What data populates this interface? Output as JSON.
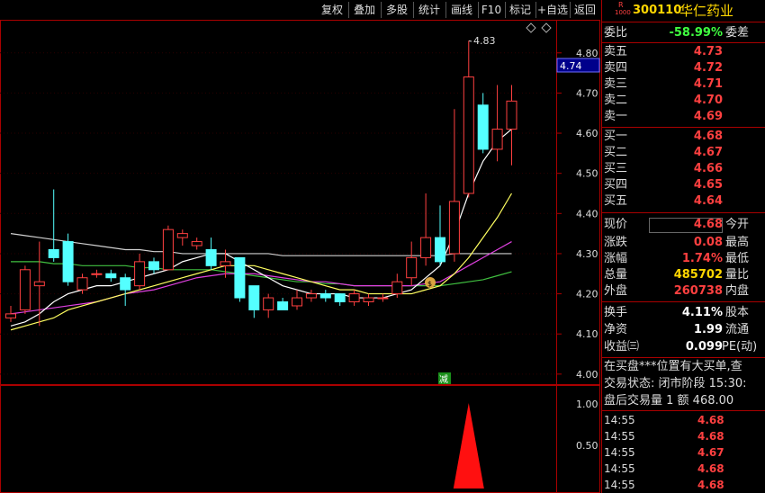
{
  "toolbar": {
    "buttons": [
      "复权",
      "叠加",
      "多股",
      "统计",
      "画线",
      "F10",
      "标记",
      "+自选",
      "返回"
    ]
  },
  "chart": {
    "price_axis_labels": [
      "4.80",
      "4.70",
      "4.60",
      "4.50",
      "4.40",
      "4.30",
      "4.20",
      "4.10",
      "4.00"
    ],
    "current_price_tag": "4.74",
    "high_marker": "4.83",
    "jian_label": "减",
    "indicator_axis_labels": [
      "1.00",
      "0.50"
    ]
  },
  "chart_data": {
    "type": "candlestick",
    "ylim": [
      3.975,
      4.86
    ],
    "candles": [
      {
        "o": 4.14,
        "c": 4.15,
        "h": 4.17,
        "l": 4.13
      },
      {
        "o": 4.16,
        "c": 4.26,
        "h": 4.27,
        "l": 4.15
      },
      {
        "o": 4.22,
        "c": 4.23,
        "h": 4.33,
        "l": 4.12
      },
      {
        "o": 4.31,
        "c": 4.29,
        "h": 4.46,
        "l": 4.28
      },
      {
        "o": 4.33,
        "c": 4.23,
        "h": 4.35,
        "l": 4.22
      },
      {
        "o": 4.21,
        "c": 4.24,
        "h": 4.25,
        "l": 4.2
      },
      {
        "o": 4.25,
        "c": 4.25,
        "h": 4.26,
        "l": 4.24
      },
      {
        "o": 4.25,
        "c": 4.24,
        "h": 4.26,
        "l": 4.23
      },
      {
        "o": 4.24,
        "c": 4.21,
        "h": 4.25,
        "l": 4.17
      },
      {
        "o": 4.22,
        "c": 4.28,
        "h": 4.3,
        "l": 4.21
      },
      {
        "o": 4.28,
        "c": 4.26,
        "h": 4.29,
        "l": 4.25
      },
      {
        "o": 4.26,
        "c": 4.36,
        "h": 4.37,
        "l": 4.26
      },
      {
        "o": 4.34,
        "c": 4.35,
        "h": 4.36,
        "l": 4.32
      },
      {
        "o": 4.32,
        "c": 4.33,
        "h": 4.34,
        "l": 4.31
      },
      {
        "o": 4.31,
        "c": 4.27,
        "h": 4.34,
        "l": 4.26
      },
      {
        "o": 4.27,
        "c": 4.28,
        "h": 4.31,
        "l": 4.24
      },
      {
        "o": 4.29,
        "c": 4.19,
        "h": 4.29,
        "l": 4.18
      },
      {
        "o": 4.22,
        "c": 4.16,
        "h": 4.22,
        "l": 4.14
      },
      {
        "o": 4.16,
        "c": 4.19,
        "h": 4.2,
        "l": 4.14
      },
      {
        "o": 4.18,
        "c": 4.16,
        "h": 4.19,
        "l": 4.16
      },
      {
        "o": 4.17,
        "c": 4.19,
        "h": 4.21,
        "l": 4.16
      },
      {
        "o": 4.19,
        "c": 4.2,
        "h": 4.21,
        "l": 4.18
      },
      {
        "o": 4.2,
        "c": 4.19,
        "h": 4.21,
        "l": 4.18
      },
      {
        "o": 4.2,
        "c": 4.18,
        "h": 4.2,
        "l": 4.17
      },
      {
        "o": 4.18,
        "c": 4.2,
        "h": 4.21,
        "l": 4.17
      },
      {
        "o": 4.18,
        "c": 4.19,
        "h": 4.2,
        "l": 4.17
      },
      {
        "o": 4.19,
        "c": 4.19,
        "h": 4.2,
        "l": 4.18
      },
      {
        "o": 4.2,
        "c": 4.23,
        "h": 4.25,
        "l": 4.19
      },
      {
        "o": 4.24,
        "c": 4.29,
        "h": 4.33,
        "l": 4.22
      },
      {
        "o": 4.29,
        "c": 4.34,
        "h": 4.45,
        "l": 4.27
      },
      {
        "o": 4.34,
        "c": 4.28,
        "h": 4.42,
        "l": 4.27
      },
      {
        "o": 4.3,
        "c": 4.43,
        "h": 4.66,
        "l": 4.28
      },
      {
        "o": 4.45,
        "c": 4.74,
        "h": 4.83,
        "l": 4.44
      },
      {
        "o": 4.67,
        "c": 4.56,
        "h": 4.7,
        "l": 4.55
      },
      {
        "o": 4.56,
        "c": 4.61,
        "h": 4.72,
        "l": 4.53
      },
      {
        "o": 4.61,
        "c": 4.68,
        "h": 4.72,
        "l": 4.52
      }
    ],
    "ma_white": [
      4.12,
      4.13,
      4.15,
      4.18,
      4.2,
      4.21,
      4.22,
      4.22,
      4.23,
      4.24,
      4.25,
      4.26,
      4.28,
      4.29,
      4.3,
      4.3,
      4.28,
      4.26,
      4.24,
      4.22,
      4.21,
      4.2,
      4.2,
      4.2,
      4.19,
      4.19,
      4.19,
      4.2,
      4.21,
      4.24,
      4.27,
      4.35,
      4.45,
      4.53,
      4.58,
      4.61
    ],
    "ma_yellow": [
      4.11,
      4.12,
      4.13,
      4.14,
      4.16,
      4.17,
      4.18,
      4.19,
      4.2,
      4.21,
      4.22,
      4.23,
      4.24,
      4.25,
      4.26,
      4.27,
      4.27,
      4.27,
      4.26,
      4.25,
      4.24,
      4.23,
      4.22,
      4.21,
      4.21,
      4.2,
      4.2,
      4.2,
      4.2,
      4.21,
      4.22,
      4.25,
      4.29,
      4.34,
      4.39,
      4.45
    ],
    "ma_magenta": [
      4.15,
      4.155,
      4.16,
      4.165,
      4.17,
      4.175,
      4.18,
      4.19,
      4.2,
      4.205,
      4.21,
      4.22,
      4.23,
      4.24,
      4.245,
      4.25,
      4.25,
      4.25,
      4.245,
      4.24,
      4.235,
      4.23,
      4.23,
      4.225,
      4.22,
      4.22,
      4.22,
      4.22,
      4.22,
      4.225,
      4.23,
      4.25,
      4.27,
      4.29,
      4.31,
      4.33
    ],
    "ma_green": [
      4.28,
      4.28,
      4.28,
      4.275,
      4.275,
      4.27,
      4.27,
      4.27,
      4.27,
      4.265,
      4.265,
      4.26,
      4.26,
      4.26,
      4.26,
      4.255,
      4.25,
      4.245,
      4.24,
      4.235,
      4.23,
      4.23,
      4.225,
      4.225,
      4.22,
      4.22,
      4.22,
      4.22,
      4.22,
      4.22,
      4.22,
      4.225,
      4.23,
      4.235,
      4.245,
      4.255
    ],
    "ma_long": [
      4.35,
      4.345,
      4.34,
      4.335,
      4.33,
      4.325,
      4.32,
      4.315,
      4.31,
      4.31,
      4.305,
      4.305,
      4.3,
      4.3,
      4.3,
      4.3,
      4.3,
      4.3,
      4.3,
      4.295,
      4.295,
      4.295,
      4.295,
      4.295,
      4.295,
      4.295,
      4.295,
      4.295,
      4.295,
      4.295,
      4.295,
      4.3,
      4.3,
      4.3,
      4.3,
      4.3
    ],
    "indicator_peak_index": 32,
    "indicator_peak_value": 1.0
  },
  "panel": {
    "stock_badge_top": "R",
    "stock_badge_bottom": "1000",
    "stock_code": "300110",
    "stock_name": "华仁药业",
    "weibi_label": "委比",
    "weibi_value": "-58.99%",
    "weicha_label": "委差",
    "sell": [
      {
        "label": "卖五",
        "price": "4.73"
      },
      {
        "label": "卖四",
        "price": "4.72"
      },
      {
        "label": "卖三",
        "price": "4.71"
      },
      {
        "label": "卖二",
        "price": "4.70"
      },
      {
        "label": "卖一",
        "price": "4.69"
      }
    ],
    "buy": [
      {
        "label": "买一",
        "price": "4.68"
      },
      {
        "label": "买二",
        "price": "4.67"
      },
      {
        "label": "买三",
        "price": "4.66"
      },
      {
        "label": "买四",
        "price": "4.65"
      },
      {
        "label": "买五",
        "price": "4.64"
      }
    ],
    "quote": [
      {
        "label": "现价",
        "value": "4.68",
        "rlabel": "今开",
        "color": "red"
      },
      {
        "label": "涨跌",
        "value": "0.08",
        "rlabel": "最高",
        "color": "red"
      },
      {
        "label": "涨幅",
        "value": "1.74%",
        "rlabel": "最低",
        "color": "red"
      },
      {
        "label": "总量",
        "value": "485702",
        "rlabel": "量比",
        "color": "yellow"
      },
      {
        "label": "外盘",
        "value": "260738",
        "rlabel": "内盘",
        "color": "red"
      }
    ],
    "stats": [
      {
        "label": "换手",
        "value": "4.11%",
        "rlabel": "股本"
      },
      {
        "label": "净资",
        "value": "1.99",
        "rlabel": "流通"
      },
      {
        "label": "收益㈢",
        "value": "0.099",
        "rlabel": "PE(动)"
      }
    ],
    "message": "在买盘***位置有大买单,查",
    "trade_status": "交易状态: 闭市阶段 15:30:",
    "after_hours": "盘后交易量 1 额 468.00",
    "ticks": [
      {
        "time": "14:55",
        "price": "4.68"
      },
      {
        "time": "14:55",
        "price": "4.68"
      },
      {
        "time": "14:55",
        "price": "4.67"
      },
      {
        "time": "14:55",
        "price": "4.68"
      },
      {
        "time": "14:55",
        "price": "4.68"
      }
    ]
  }
}
